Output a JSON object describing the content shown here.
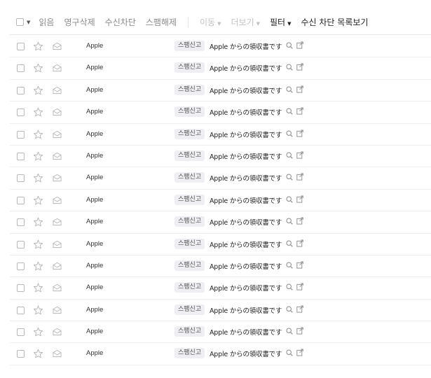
{
  "toolbar": {
    "read": "읽음",
    "delete_permanent": "영구삭제",
    "block": "수신차단",
    "unspam": "스팸해제",
    "move": "이동",
    "more": "더보기",
    "filter": "필터",
    "block_list": "수신 차단 목록보기"
  },
  "mails": [
    {
      "sender": "Apple",
      "tag": "스팸신고",
      "subject": "Apple からの領収書です"
    },
    {
      "sender": "Apple",
      "tag": "스팸신고",
      "subject": "Apple からの領収書です"
    },
    {
      "sender": "Apple",
      "tag": "스팸신고",
      "subject": "Apple からの領収書です"
    },
    {
      "sender": "Apple",
      "tag": "스팸신고",
      "subject": "Apple からの領収書です"
    },
    {
      "sender": "Apple",
      "tag": "스팸신고",
      "subject": "Apple からの領収書です"
    },
    {
      "sender": "Apple",
      "tag": "스팸신고",
      "subject": "Apple からの領収書です"
    },
    {
      "sender": "Apple",
      "tag": "스팸신고",
      "subject": "Apple からの領収書です"
    },
    {
      "sender": "Apple",
      "tag": "스팸신고",
      "subject": "Apple からの領収書です"
    },
    {
      "sender": "Apple",
      "tag": "스팸신고",
      "subject": "Apple からの領収書です"
    },
    {
      "sender": "Apple",
      "tag": "스팸신고",
      "subject": "Apple からの領収書です"
    },
    {
      "sender": "Apple",
      "tag": "스팸신고",
      "subject": "Apple からの領収書です"
    },
    {
      "sender": "Apple",
      "tag": "스팸신고",
      "subject": "Apple からの領収書です"
    },
    {
      "sender": "Apple",
      "tag": "스팸신고",
      "subject": "Apple からの領収書です"
    },
    {
      "sender": "Apple",
      "tag": "스팸신고",
      "subject": "Apple からの領収書です"
    },
    {
      "sender": "Apple",
      "tag": "스팸신고",
      "subject": "Apple からの領収書です"
    }
  ]
}
